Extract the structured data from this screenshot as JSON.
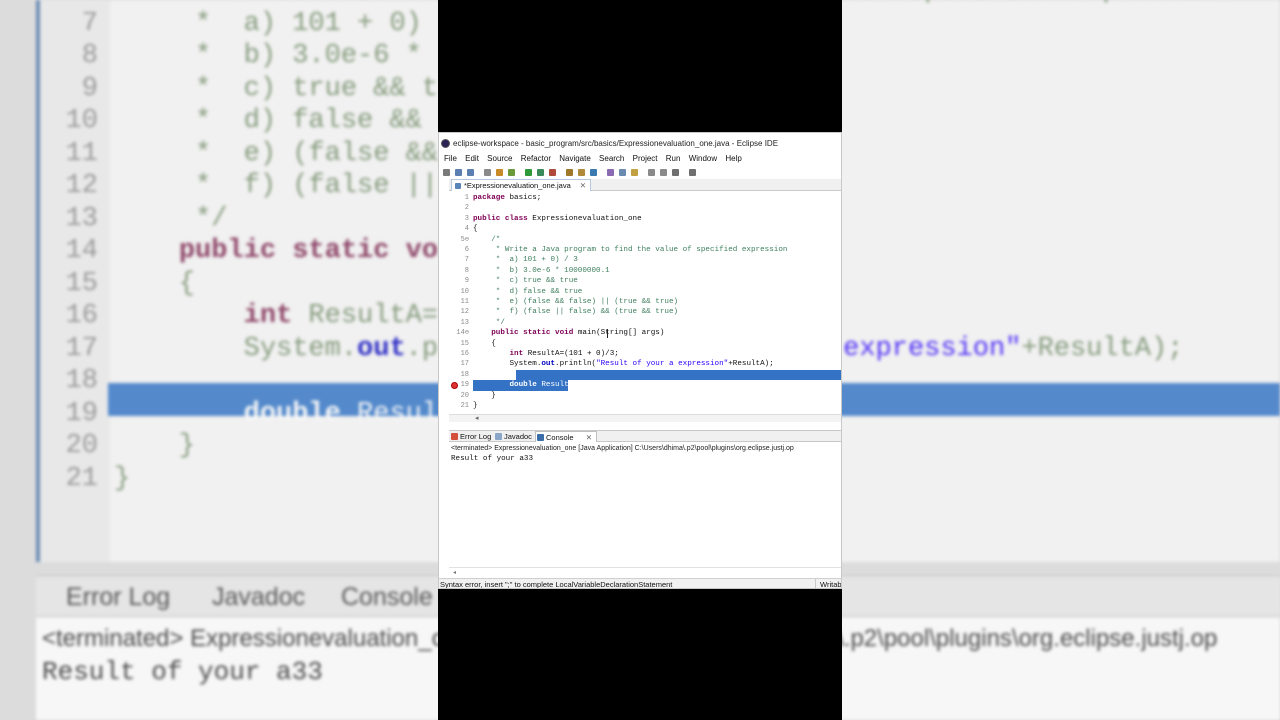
{
  "window": {
    "title": "eclipse-workspace - basic_program/src/basics/Expressionevaluation_one.java - Eclipse IDE"
  },
  "menu": [
    "File",
    "Edit",
    "Source",
    "Refactor",
    "Navigate",
    "Search",
    "Project",
    "Run",
    "Window",
    "Help"
  ],
  "toolbar": {
    "icons": [
      "new-icon",
      "save-icon",
      "save-all-icon",
      "print-icon",
      "build-icon",
      "debug-icon",
      "run-icon",
      "coverage-icon",
      "external-tools-icon",
      "new-java-project-icon",
      "new-package-icon",
      "new-class-icon",
      "open-type-icon",
      "search-icon",
      "toggle-mark-icon",
      "annotation-next-icon",
      "annotation-prev-icon",
      "back-icon",
      "forward-icon"
    ]
  },
  "editor": {
    "tab_label": "*Expressionevaluation_one.java",
    "lines": [
      {
        "n": "1",
        "code": "package basics;"
      },
      {
        "n": "2",
        "code": ""
      },
      {
        "n": "3",
        "code": "public class Expressionevaluation_one"
      },
      {
        "n": "4",
        "code": "{"
      },
      {
        "n": "5⊖",
        "code": "    /*"
      },
      {
        "n": "6",
        "code": "     * Write a Java program to find the value of specified expression"
      },
      {
        "n": "7",
        "code": "     *  a) 101 + 0) / 3"
      },
      {
        "n": "8",
        "code": "     *  b) 3.0e-6 * 10000000.1"
      },
      {
        "n": "9",
        "code": "     *  c) true && true"
      },
      {
        "n": "10",
        "code": "     *  d) false && true"
      },
      {
        "n": "11",
        "code": "     *  e) (false && false) || (true && true)"
      },
      {
        "n": "12",
        "code": "     *  f) (false || false) && (true && true)"
      },
      {
        "n": "13",
        "code": "     */"
      },
      {
        "n": "14⊖",
        "code": "    public static void main(String[] args)"
      },
      {
        "n": "15",
        "code": "    {"
      },
      {
        "n": "16",
        "code": "        int ResultA=(101 + 0)/3;"
      },
      {
        "n": "17",
        "code": "        System.out.println(\"Result of your a expression\"+ResultA);"
      },
      {
        "n": "18",
        "code": ""
      },
      {
        "n": "19",
        "code": "        double ResultB"
      },
      {
        "n": "20",
        "code": "    }"
      },
      {
        "n": "21",
        "code": "}"
      }
    ]
  },
  "views": {
    "tabs": [
      "Error Log",
      "Javadoc",
      "Console"
    ],
    "active_tab": "Console",
    "console_status": "<terminated> Expressionevaluation_one [Java Application] C:\\Users\\dhima\\.p2\\pool\\plugins\\org.eclipse.justj.op",
    "console_output": "Result of your a33"
  },
  "status": {
    "message": "Syntax error, insert \";\" to complete LocalVariableDeclarationStatement",
    "mode": "Writab"
  },
  "background": {
    "tabs": [
      "Error Log",
      "Javadoc",
      "Console"
    ],
    "console_status": "<terminated> Expressionevaluation_one [Java Application] C:\\Users\\dhima\\.p2\\pool\\plugins\\org.eclipse.justj.op",
    "console_output": "Result of your a33",
    "code_lines": [
      {
        "n": "6",
        "code": "     * Write a Java program to find the value of specified expression"
      },
      {
        "n": "7",
        "code": "     *  a) 101 + 0) / 3"
      },
      {
        "n": "8",
        "code": "     *  b) 3.0e-6 * 10000000.1"
      },
      {
        "n": "9",
        "code": "     *  c) true && true"
      },
      {
        "n": "10",
        "code": "     *  d) false && true"
      },
      {
        "n": "11",
        "code": "     *  e) (false && false) || (true && true)"
      },
      {
        "n": "12",
        "code": "     *  f) (false || false) && (true && true)"
      },
      {
        "n": "13",
        "code": "     */"
      },
      {
        "n": "14",
        "code": "    public static void main(String[] args)"
      },
      {
        "n": "15",
        "code": "    {"
      },
      {
        "n": "16",
        "code": "        int ResultA=(101 + 0)/3;"
      },
      {
        "n": "17",
        "code": "        System.out.println(\"Result of your a expression\"+ResultA);"
      },
      {
        "n": "18",
        "code": ""
      },
      {
        "n": "19",
        "code": "        double ResultB"
      },
      {
        "n": "20",
        "code": "    }"
      },
      {
        "n": "21",
        "code": "}"
      }
    ]
  },
  "colors": {
    "selection": "#3372c5",
    "keyword": "#7f0055",
    "comment": "#3f7f5f",
    "string": "#2a00ff",
    "field": "#0000c0"
  }
}
